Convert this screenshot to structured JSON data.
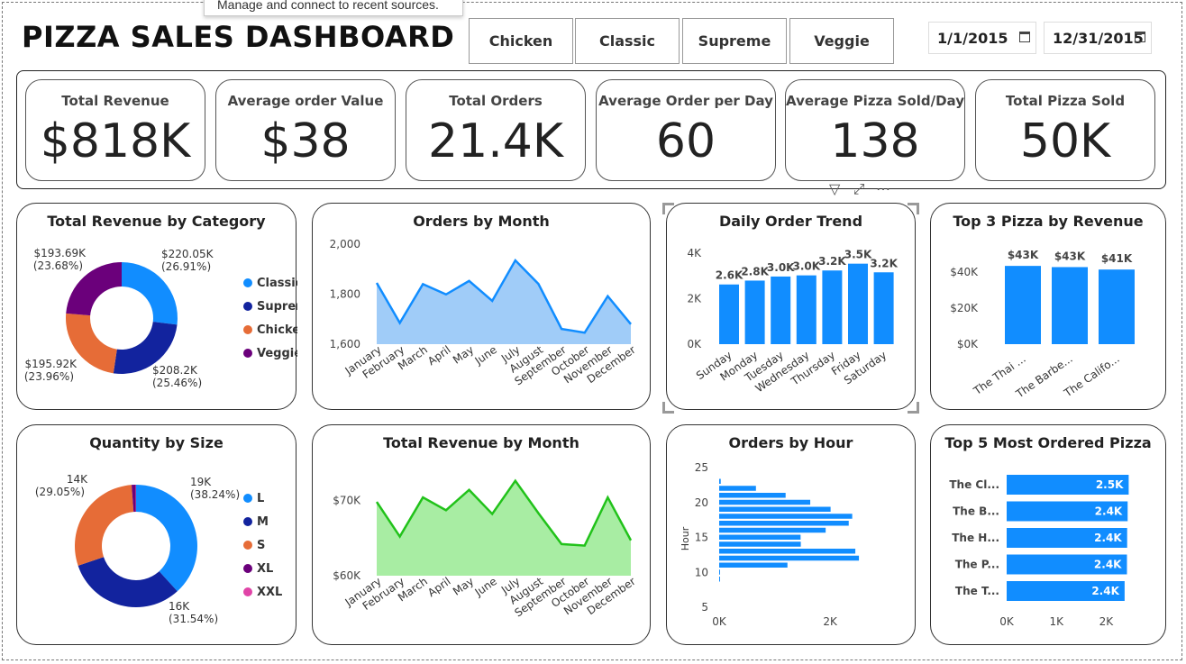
{
  "header": {
    "title": "PIZZA SALES DASHBOARD",
    "tooltip": "Manage and connect to recent sources.",
    "category_tiles": [
      "Chicken",
      "Classic",
      "Supreme",
      "Veggie"
    ],
    "date_start": "1/1/2015",
    "date_end": "12/31/2015"
  },
  "kpis": [
    {
      "label": "Total Revenue",
      "value": "$818K"
    },
    {
      "label": "Average order Value",
      "value": "$38"
    },
    {
      "label": "Total Orders",
      "value": "21.4K"
    },
    {
      "label": "Average Order per Day",
      "value": "60"
    },
    {
      "label": "Average Pizza Sold/Day",
      "value": "138"
    },
    {
      "label": "Total Pizza Sold",
      "value": "50K"
    }
  ],
  "colors": {
    "blue": "#118DFF",
    "navy": "#12239E",
    "orange": "#E66C37",
    "purple": "#6B007B",
    "pink": "#E044A7",
    "light_blue_fill": "#A0CCF8",
    "green_line": "#21C21A",
    "green_fill": "#A8EDA3"
  },
  "chart_data": [
    {
      "id": "revenue_by_category",
      "type": "pie",
      "title": "Total Revenue by Category",
      "categories": [
        "Classic",
        "Supreme",
        "Chicken",
        "Veggie"
      ],
      "values": [
        220.05,
        208.2,
        195.92,
        193.69
      ],
      "value_labels": [
        "$220.05K",
        "$208.2K",
        "$195.92K",
        "$193.69K"
      ],
      "percent_labels": [
        "(26.91%)",
        "(25.46%)",
        "(23.96%)",
        "(23.68%)"
      ],
      "legend": "right"
    },
    {
      "id": "orders_by_month",
      "type": "area",
      "title": "Orders by Month",
      "categories": [
        "January",
        "February",
        "March",
        "April",
        "May",
        "June",
        "July",
        "August",
        "September",
        "October",
        "November",
        "December"
      ],
      "values": [
        1845,
        1685,
        1840,
        1799,
        1853,
        1773,
        1935,
        1841,
        1661,
        1646,
        1792,
        1680
      ],
      "ylim": [
        1600,
        2000
      ],
      "yticks": [
        "1,600",
        "1,800",
        "2,000"
      ]
    },
    {
      "id": "daily_order_trend",
      "type": "bar",
      "title": "Daily Order Trend",
      "categories": [
        "Sunday",
        "Monday",
        "Tuesday",
        "Wednesday",
        "Thursday",
        "Friday",
        "Saturday"
      ],
      "values": [
        2624,
        2794,
        2973,
        3024,
        3239,
        3538,
        3158
      ],
      "data_labels": [
        "2.6K",
        "2.8K",
        "3.0K",
        "3.0K",
        "3.2K",
        "3.5K",
        "3.2K"
      ],
      "ylim": [
        0,
        4000
      ],
      "yticks": [
        "0K",
        "2K",
        "4K"
      ]
    },
    {
      "id": "top3_pizza_revenue",
      "type": "bar",
      "title": "Top 3 Pizza by Revenue",
      "categories": [
        "The Thai ...",
        "The Barbe...",
        "The Califo..."
      ],
      "values": [
        43434,
        42768,
        41410
      ],
      "data_labels": [
        "$43K",
        "$43K",
        "$41K"
      ],
      "ylim": [
        0,
        40000
      ],
      "yticks": [
        "$0K",
        "$20K",
        "$40K"
      ]
    },
    {
      "id": "quantity_by_size",
      "type": "pie",
      "title": "Quantity by Size",
      "categories": [
        "L",
        "M",
        "S",
        "XL",
        "XXL"
      ],
      "values": [
        38.24,
        31.54,
        29.05,
        1.1,
        0.07
      ],
      "value_labels": [
        "19K",
        "16K",
        "14K"
      ],
      "percent_labels": [
        "(38.24%)",
        "(31.54%)",
        "(29.05%)"
      ],
      "legend": "right"
    },
    {
      "id": "revenue_by_month",
      "type": "area",
      "title": "Total Revenue by Month",
      "categories": [
        "January",
        "February",
        "March",
        "April",
        "May",
        "June",
        "July",
        "August",
        "September",
        "October",
        "November",
        "December"
      ],
      "values": [
        69.8,
        65.2,
        70.4,
        68.7,
        71.4,
        68.2,
        72.6,
        68.3,
        64.2,
        64.0,
        70.4,
        64.7
      ],
      "ylim": [
        60,
        74
      ],
      "yticks": [
        "$60K",
        "$70K"
      ]
    },
    {
      "id": "orders_by_hour",
      "type": "bar",
      "title": "Orders by Hour",
      "ylabel": "Hour",
      "hours": [
        9,
        10,
        11,
        12,
        13,
        14,
        15,
        16,
        17,
        18,
        19,
        20,
        21,
        22,
        23
      ],
      "values": [
        1,
        8,
        1231,
        2520,
        2455,
        1472,
        1468,
        1920,
        2336,
        2399,
        2009,
        1642,
        1198,
        663,
        28
      ],
      "ylim": [
        5,
        25
      ],
      "yticks": [
        "5",
        "10",
        "15",
        "20",
        "25"
      ],
      "xticks": [
        "0K",
        "2K"
      ],
      "xlim": [
        0,
        2600
      ]
    },
    {
      "id": "top5_ordered_pizza",
      "type": "bar",
      "title": "Top 5 Most Ordered Pizza",
      "categories": [
        "The Cl...",
        "The B...",
        "The H...",
        "The P...",
        "The T..."
      ],
      "values": [
        2453,
        2432,
        2422,
        2418,
        2371
      ],
      "data_labels": [
        "2.5K",
        "2.4K",
        "2.4K",
        "2.4K",
        "2.4K"
      ],
      "xlim": [
        0,
        2500
      ],
      "xticks": [
        "0K",
        "1K",
        "2K"
      ]
    }
  ]
}
